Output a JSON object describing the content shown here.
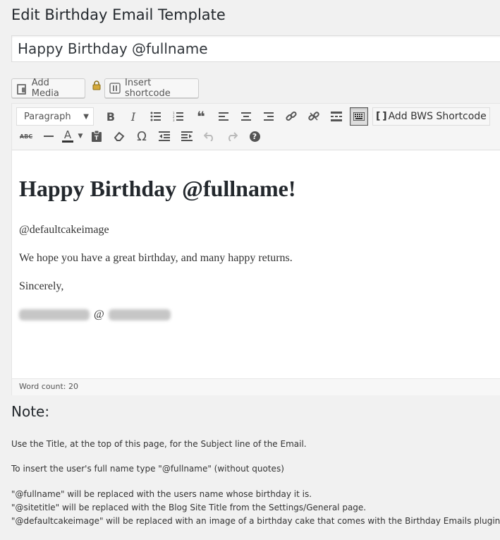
{
  "page": {
    "title": "Edit Birthday Email Template"
  },
  "title_field": {
    "value": "Happy Birthday @fullname"
  },
  "buttons": {
    "add_media": "Add Media",
    "insert_shortcode": "Insert shortcode"
  },
  "toolbar": {
    "format_value": "Paragraph",
    "add_bws_shortcode": "Add BWS Shortcode",
    "bold": "B",
    "italic": "I",
    "blockquote": "❝",
    "omega": "Ω",
    "help": "?",
    "text_color": "A",
    "strike": "ABC"
  },
  "content": {
    "heading": "Happy Birthday @fullname!",
    "p1": "@defaultcakeimage",
    "p2": "We hope you have a great birthday, and many happy returns.",
    "p3": "Sincerely,",
    "p4_at": "@"
  },
  "footer": {
    "word_count": "Word count: 20"
  },
  "note": {
    "title": "Note:",
    "line1": "Use the Title, at the top of this page, for the Subject line of the Email.",
    "line2": "To insert the user's full name type \"@fullname\" (without quotes)",
    "line3": "\"@fullname\" will be replaced with the users name whose birthday it is.",
    "line4": "\"@sitetitle\" will be replaced with the Blog Site Title from the Settings/General page.",
    "line5": "\"@defaultcakeimage\" will be replaced with an image of a birthday cake that comes with the Birthday Emails plugin."
  },
  "icons": [
    "add-media-icon",
    "lock-icon",
    "insert-shortcode-icon",
    "bold-icon",
    "italic-icon",
    "bulleted-list-icon",
    "numbered-list-icon",
    "blockquote-icon",
    "align-left-icon",
    "align-center-icon",
    "align-right-icon",
    "link-icon",
    "unlink-icon",
    "read-more-icon",
    "toolbar-toggle-icon",
    "strikethrough-icon",
    "horizontal-line-icon",
    "text-color-icon",
    "paste-as-text-icon",
    "clear-formatting-icon",
    "special-character-icon",
    "outdent-icon",
    "indent-icon",
    "undo-icon",
    "redo-icon",
    "help-icon"
  ]
}
